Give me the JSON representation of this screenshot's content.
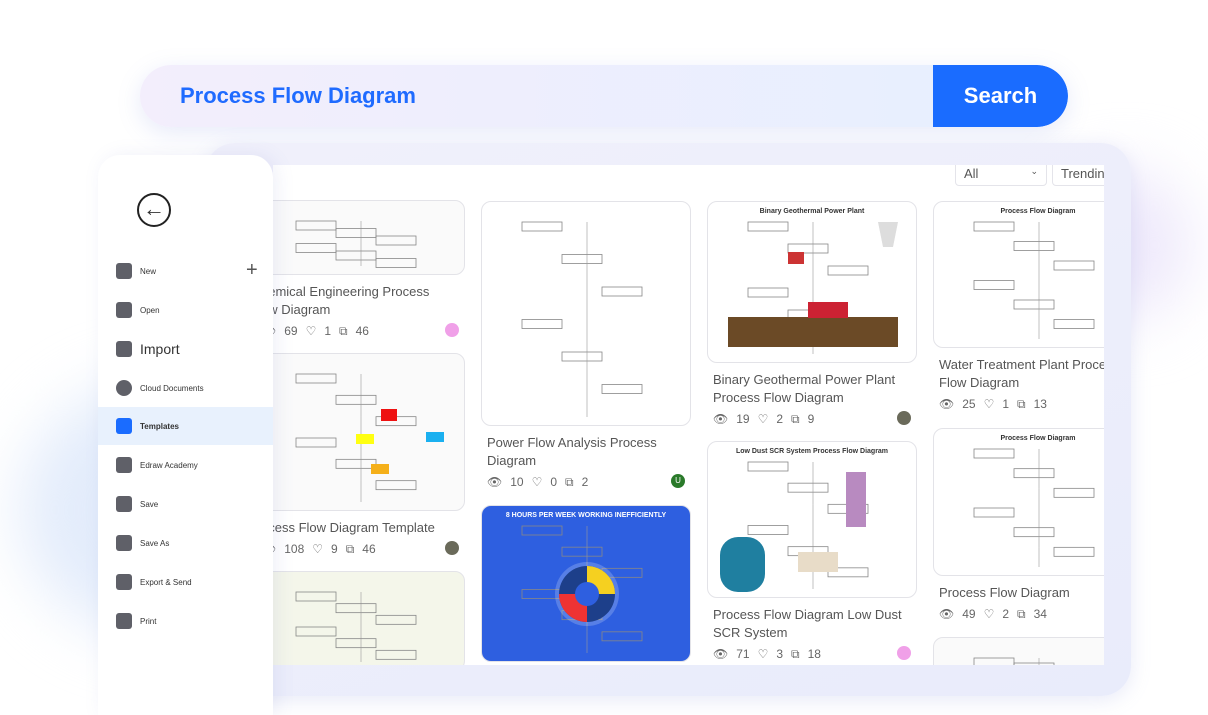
{
  "search": {
    "query": "Process Flow Diagram",
    "button": "Search"
  },
  "filters": {
    "category": "All",
    "sort": "Trending"
  },
  "sidebar": {
    "items": [
      {
        "label": "New",
        "icon": "plus-square-icon"
      },
      {
        "label": "Open",
        "icon": "folder-icon"
      },
      {
        "label": "Import",
        "icon": "import-icon"
      },
      {
        "label": "Cloud Documents",
        "icon": "cloud-icon"
      },
      {
        "label": "Templates",
        "icon": "templates-icon"
      },
      {
        "label": "Edraw Academy",
        "icon": "graduation-cap-icon"
      },
      {
        "label": "Save",
        "icon": "save-icon"
      },
      {
        "label": "Save As",
        "icon": "save-as-icon"
      },
      {
        "label": "Export & Send",
        "icon": "export-icon"
      },
      {
        "label": "Print",
        "icon": "print-icon"
      }
    ]
  },
  "cards": [
    {
      "title1": "hemical Engineering Process",
      "title2": "ow Diagram",
      "views": "69",
      "likes": "1",
      "copies": "46"
    },
    {
      "title1": "ocess Flow Diagram Template",
      "title2": "",
      "views": "108",
      "likes": "9",
      "copies": "46"
    },
    {
      "title1": "",
      "title2": "",
      "views": "",
      "likes": "",
      "copies": ""
    },
    {
      "title1": "Power Flow Analysis Process",
      "title2": "Diagram",
      "views": "10",
      "likes": "0",
      "copies": "2",
      "avatar": "U"
    },
    {
      "title1": "",
      "title2": "",
      "views": "",
      "likes": "",
      "copies": "",
      "thumb_title": "8 HOURS PER WEEK WORKING INEFFICIENTLY"
    },
    {
      "title1": "Binary Geothermal Power Plant",
      "title2": "Process Flow Diagram",
      "views": "19",
      "likes": "2",
      "copies": "9",
      "thumb_title": "Binary Geothermal Power Plant"
    },
    {
      "title1": "Process Flow Diagram Low Dust",
      "title2": "SCR System",
      "views": "71",
      "likes": "3",
      "copies": "18",
      "thumb_title": "Low Dust SCR System Process Flow Diagram"
    },
    {
      "title1": "Water Treatment Plant Proce",
      "title2": "Flow Diagram",
      "views": "25",
      "likes": "1",
      "copies": "13",
      "thumb_title": "Process Flow Diagram"
    },
    {
      "title1": "Process Flow Diagram",
      "title2": "",
      "views": "49",
      "likes": "2",
      "copies": "34",
      "thumb_title": "Process Flow Diagram"
    },
    {
      "title1": "",
      "title2": "",
      "views": "",
      "likes": "",
      "copies": ""
    }
  ],
  "colors": {
    "accent": "#1a6cff",
    "active_bg": "#e8f1fd"
  }
}
